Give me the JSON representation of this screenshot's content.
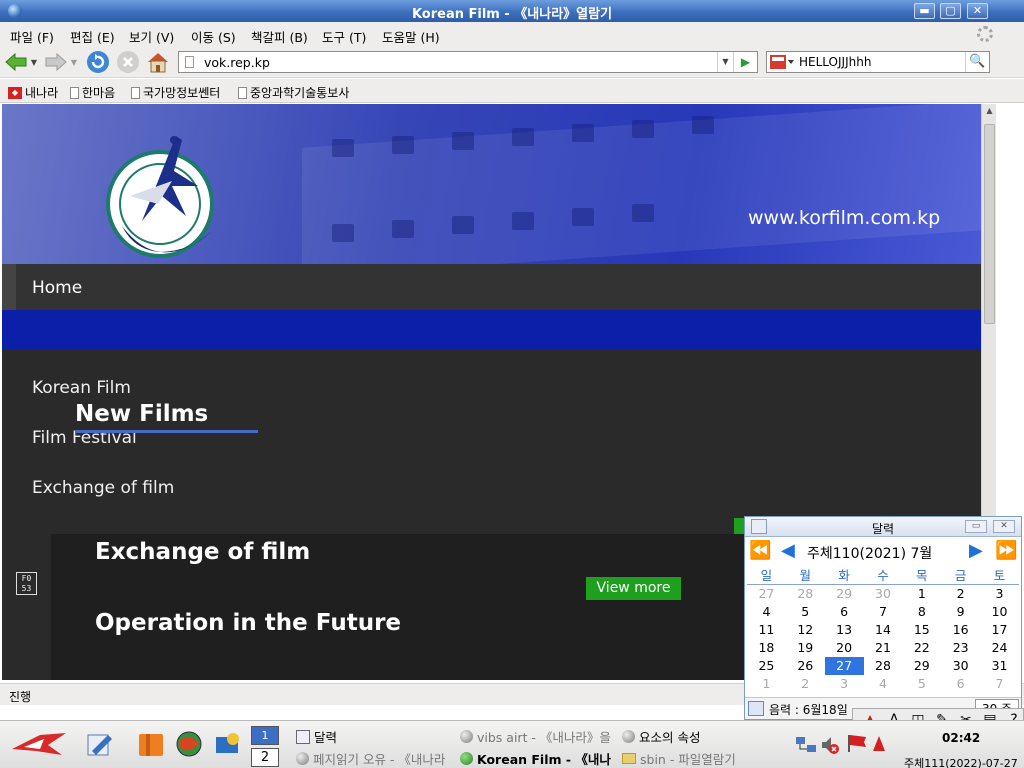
{
  "window": {
    "title": "Korean Film - 《내나라》열람기",
    "minimize": "▬",
    "maximize": "▢",
    "close": "✕"
  },
  "menu": [
    "파일 (F)",
    "편집 (E)",
    "보기 (V)",
    "이동 (S)",
    "책갈피 (B)",
    "도구 (T)",
    "도움말 (H)"
  ],
  "nav": {
    "url": "vok.rep.kp",
    "search_value": "HELLOJJJhhh"
  },
  "bookmarks": [
    "내나라",
    "한마음",
    "국가망정보쎈터",
    "중앙과학기술통보사"
  ],
  "site": {
    "url_text": "www.korfilm.com.kp",
    "home": "Home",
    "links": [
      "Korean Film",
      "Film Festival",
      "Exchange of film"
    ],
    "section_title": "New Films",
    "slide_title_1": "Exchange of film",
    "slide_title_2": "Operation in the Future",
    "view_more": "View more",
    "slide_counter": "F0 53"
  },
  "status": {
    "text": "진행"
  },
  "calendar": {
    "title": "달력",
    "month_label": "주체110(2021)  7월",
    "weekdays": [
      "일",
      "월",
      "화",
      "수",
      "목",
      "금",
      "토"
    ],
    "weeks": [
      [
        {
          "d": "27",
          "o": true
        },
        {
          "d": "28",
          "o": true
        },
        {
          "d": "29",
          "o": true
        },
        {
          "d": "30",
          "o": true
        },
        {
          "d": "1"
        },
        {
          "d": "2"
        },
        {
          "d": "3"
        }
      ],
      [
        {
          "d": "4"
        },
        {
          "d": "5"
        },
        {
          "d": "6"
        },
        {
          "d": "7"
        },
        {
          "d": "8"
        },
        {
          "d": "9"
        },
        {
          "d": "10"
        }
      ],
      [
        {
          "d": "11"
        },
        {
          "d": "12"
        },
        {
          "d": "13"
        },
        {
          "d": "14"
        },
        {
          "d": "15"
        },
        {
          "d": "16"
        },
        {
          "d": "17"
        }
      ],
      [
        {
          "d": "18"
        },
        {
          "d": "19"
        },
        {
          "d": "20"
        },
        {
          "d": "21"
        },
        {
          "d": "22"
        },
        {
          "d": "23"
        },
        {
          "d": "24"
        }
      ],
      [
        {
          "d": "25"
        },
        {
          "d": "26"
        },
        {
          "d": "27",
          "t": true
        },
        {
          "d": "28"
        },
        {
          "d": "29"
        },
        {
          "d": "30"
        },
        {
          "d": "31"
        }
      ],
      [
        {
          "d": "1",
          "o": true
        },
        {
          "d": "2",
          "o": true
        },
        {
          "d": "3",
          "o": true
        },
        {
          "d": "4",
          "o": true
        },
        {
          "d": "5",
          "o": true
        },
        {
          "d": "6",
          "o": true
        },
        {
          "d": "7",
          "o": true
        }
      ]
    ],
    "lunar": "음력 : 6월18일",
    "days": "30 주"
  },
  "taskbar": {
    "workspace_1": "1",
    "workspace_2": "2",
    "tasks": [
      {
        "label": "달력",
        "state": "normal"
      },
      {
        "label": "vibs airt - 《내나라》을",
        "state": "dim"
      },
      {
        "label": "요소의 속성",
        "state": "normal"
      },
      {
        "label": "페지읽기 오유 - 《내나라",
        "state": "dim"
      },
      {
        "label": "Korean Film - 《내나",
        "state": "active"
      },
      {
        "label": "sbin - 파일열람기",
        "state": "dim"
      }
    ],
    "clock": "02:42",
    "date": "주체111(2022)-07-27"
  },
  "colors": {
    "banner": "#2738b9",
    "accent_green": "#1ea01e",
    "today": "#2f74e0"
  }
}
